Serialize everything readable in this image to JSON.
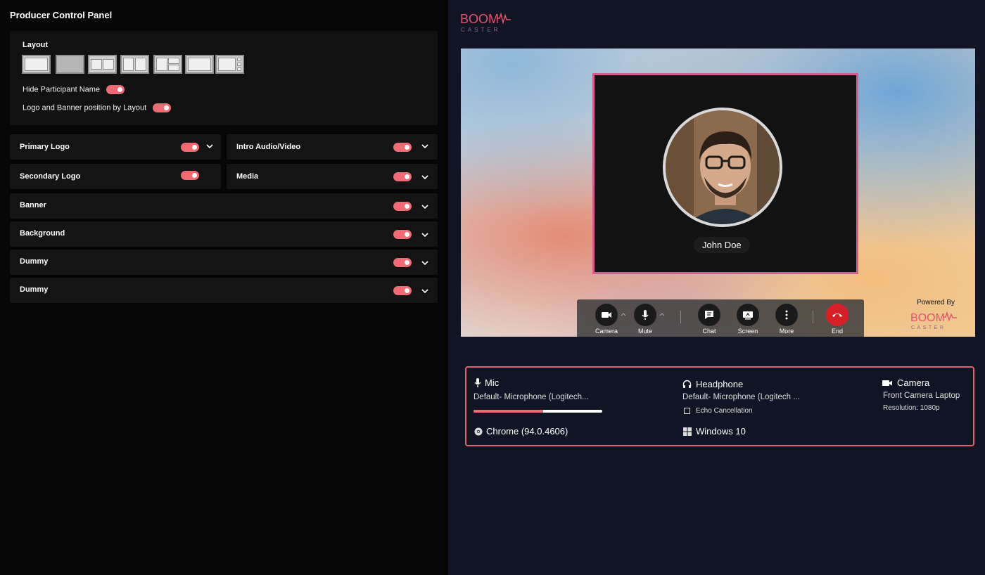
{
  "panel": {
    "title": "Producer Control Panel",
    "layout_label": "Layout",
    "hide_participant_name": "Hide Participant Name",
    "logo_banner_position": "Logo and Banner position by Layout"
  },
  "sections": [
    {
      "label": "Primary Logo",
      "enabled": true
    },
    {
      "label": "Intro Audio/Video",
      "enabled": true
    },
    {
      "label": "Secondary Logo",
      "enabled": true
    },
    {
      "label": "Media",
      "enabled": true
    },
    {
      "label": "Banner",
      "enabled": true
    },
    {
      "label": "Background",
      "enabled": true
    },
    {
      "label": "Dummy",
      "enabled": true
    },
    {
      "label": "Dummy",
      "enabled": true
    }
  ],
  "brand": {
    "logo_text_top": "BOOM",
    "logo_text_bottom": "CASTER",
    "accent": "#ef6a72"
  },
  "stage": {
    "participant_name": "John Doe",
    "powered_by": "Powered By"
  },
  "controls": {
    "camera": "Camera",
    "mute": "Mute",
    "chat": "Chat",
    "screen": "Screen",
    "more": "More",
    "end": "End"
  },
  "device_info": {
    "mic_title": "Mic",
    "mic_device": "Default- Microphone (Logitech...",
    "mic_level": 0.54,
    "headphone_title": "Headphone",
    "headphone_device": "Default- Microphone (Logitech ...",
    "echo_cancellation": "Echo Cancellation",
    "camera_title": "Camera",
    "camera_device": "Front Camera Laptop",
    "camera_resolution": "Resolution: 1080p",
    "browser": "Chrome (94.0.4606)",
    "os": "Windows 10"
  }
}
